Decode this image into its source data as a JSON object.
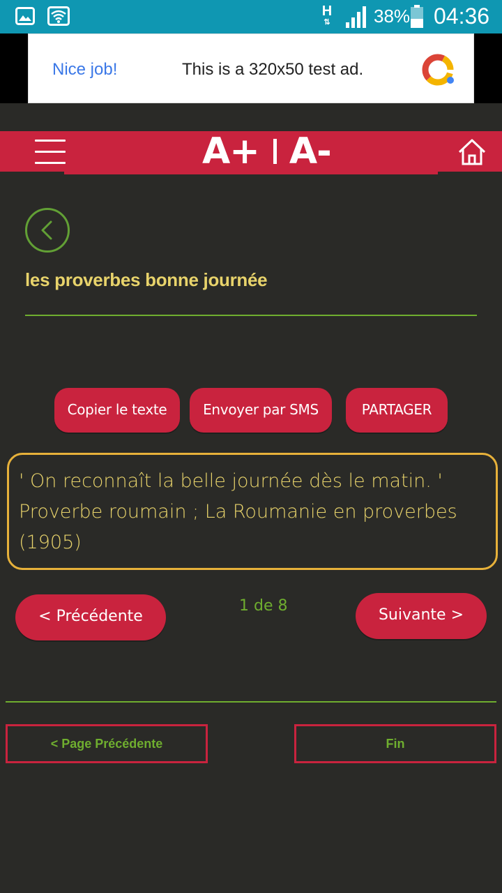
{
  "status_bar": {
    "network_type": "H",
    "battery_percent": "38%",
    "time": "04:36",
    "icons": [
      "gallery-icon",
      "wifi-icon",
      "signal-icon",
      "battery-icon"
    ]
  },
  "ad": {
    "nice_label": "Nice job!",
    "text": "This is a 320x50 test ad."
  },
  "header": {
    "font_increase": "A+",
    "font_decrease": "A-",
    "icons": [
      "menu-icon",
      "home-icon"
    ]
  },
  "page": {
    "title": "les proverbes bonne journée"
  },
  "actions": {
    "copy": "Copier le texte",
    "sms": "Envoyer par SMS",
    "share": "PARTAGER"
  },
  "quote": {
    "text": "' On reconnaît la belle journée dès le matin. ' Proverbe roumain ; La Roumanie en proverbes (1905)"
  },
  "pager": {
    "prev": "< Précédente",
    "next": "Suivante >",
    "count": "1 de 8"
  },
  "bottom_nav": {
    "prev_page": "< Page Précédente",
    "end": "Fin"
  },
  "colors": {
    "background": "#2a2a27",
    "accent_red": "#c9233e",
    "status_bar": "#0f97b2",
    "green": "#6fae2f",
    "yellow_text": "#e8d36b",
    "quote_border": "#e7b13a"
  }
}
